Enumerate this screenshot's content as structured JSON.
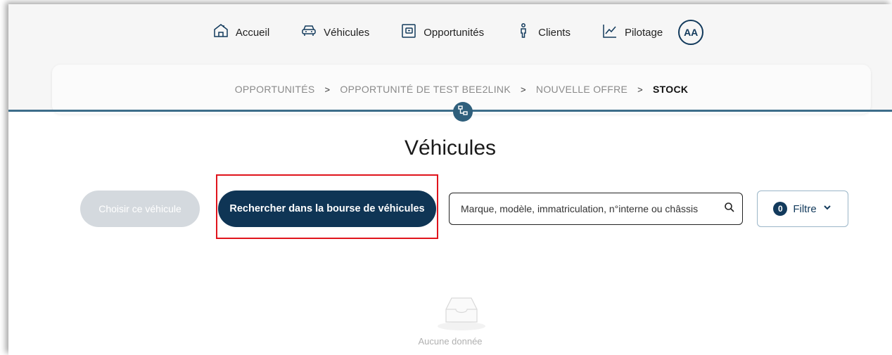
{
  "nav": {
    "items": [
      {
        "label": "Accueil",
        "icon": "home-icon"
      },
      {
        "label": "Véhicules",
        "icon": "car-icon"
      },
      {
        "label": "Opportunités",
        "icon": "wallet-icon"
      },
      {
        "label": "Clients",
        "icon": "person-icon"
      },
      {
        "label": "Pilotage",
        "icon": "chart-icon"
      }
    ],
    "avatar": "AA"
  },
  "breadcrumb": {
    "items": [
      "OPPORTUNITÉS",
      "OPPORTUNITÉ DE TEST BEE2LINK",
      "NOUVELLE OFFRE"
    ],
    "current": "STOCK",
    "separator": ">"
  },
  "page": {
    "title": "Véhicules"
  },
  "actions": {
    "choose_label": "Choisir ce véhicule",
    "search_exchange_label": "Rechercher dans la bourse de véhicules"
  },
  "search": {
    "placeholder": "Marque, modèle, immatriculation, n°interne ou châssis",
    "value": ""
  },
  "filter": {
    "count": "0",
    "label": "Filtre"
  },
  "empty": {
    "text": "Aucune donnée"
  },
  "colors": {
    "primary": "#0f3555",
    "accent_line": "#3d6d8a",
    "highlight": "#e0141c",
    "disabled": "#d4d9de"
  }
}
